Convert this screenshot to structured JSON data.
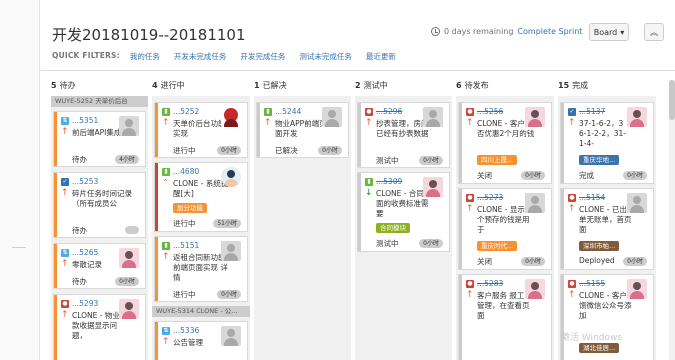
{
  "header": {
    "title": "开发20181019--20181101",
    "days_remaining": "0 days remaining",
    "complete_sprint": "Complete Sprint",
    "board_button": "Board",
    "collapse_icon": "chevron-up-icon"
  },
  "quick_filters": {
    "label": "QUICK FILTERS:",
    "items": [
      "我的任务",
      "开发未完成任务",
      "开发完成任务",
      "测试未完成任务",
      "最近更新"
    ]
  },
  "colors": {
    "link": "#3572b0",
    "priority_grab": "#f79232",
    "type_task": "#4a6785",
    "type_subtask": "#4bade8",
    "type_story": "#63ba3c",
    "type_bug": "#d04437",
    "epic_orange": "#f79232",
    "epic_green": "#8eb021",
    "epic_brown": "#815b3a",
    "epic_blue": "#3b73af"
  },
  "columns": {
    "todo": {
      "count": "5",
      "name": "待办",
      "swimlane": "WUYE-5252",
      "swimlane_text": "天单价后台",
      "cards": [
        {
          "key": "...5351",
          "summary": "前后端API集成",
          "status": "待办",
          "estimate": "4小时"
        },
        {
          "key": "...5253",
          "summary": "碎片任务时间记录（所有成员公",
          "status": "待办"
        },
        {
          "key": "...5265",
          "summary": "零散记录",
          "status": "待办",
          "estimate": "0小时"
        },
        {
          "key": "...5293",
          "summary": "CLONE - 物业收款收据显示问题，"
        }
      ]
    },
    "in_progress": {
      "count": "4",
      "name": "进行中",
      "swimlane": "WUYE-5314",
      "swimlane_text": "CLONE - 公...",
      "cards": [
        {
          "key": "...5252",
          "summary": "天单价后台功能实现",
          "status": "进行中",
          "estimate": "0小时"
        },
        {
          "key": "...4680",
          "summary": "CLONE - 系统提醒[大]",
          "epic": "加分功能",
          "status": "进行中",
          "estimate": "51小时"
        },
        {
          "key": "...5151",
          "summary": "返租合同新功能-前端页面实现 详情",
          "status": "进行中",
          "estimate": "0小时"
        },
        {
          "key": "...5336",
          "summary": "公告管理"
        }
      ]
    },
    "resolved": {
      "count": "1",
      "name": "已解决",
      "cards": [
        {
          "key": "...5244",
          "summary": "物业APP前端页面开发",
          "status": "已解决",
          "estimate": "0小时"
        }
      ]
    },
    "testing": {
      "count": "2",
      "name": "测试中",
      "cards": [
        {
          "key": "...5296",
          "summary": "抄表管理，房间已经有抄表数据",
          "status": "测试中",
          "estimate": "0小时"
        },
        {
          "key": "...5309",
          "summary": "CLONE - 合同里面的收费标准需要",
          "epic": "合同模块",
          "status": "测试中",
          "estimate": "0小时"
        }
      ]
    },
    "to_release": {
      "count": "6",
      "name": "待发布",
      "cards": [
        {
          "key": "...5256",
          "summary": "CLONE - 客户是否优惠2个月的钱",
          "epic": "四川上晟...",
          "status": "关闭",
          "estimate": "0小时"
        },
        {
          "key": "...5273",
          "summary": "CLONE - 显示这个预存的钱是用于",
          "epic": "重庆时代...",
          "status": "关闭",
          "estimate": "0小时"
        },
        {
          "key": "...5283",
          "summary": "客户服务 报工单管理，在查看页面"
        }
      ]
    },
    "done": {
      "count": "15",
      "name": "完成",
      "cards": [
        {
          "key": "...5137",
          "summary": "37-1-6-2，36-1-2-2，31-1-4-",
          "epic": "重庆华地...",
          "status": "完成",
          "estimate": "0小时"
        },
        {
          "key": "...5154",
          "summary": "CLONE - 已出账单无账单，首页面",
          "epic": "深圳市帕...",
          "status": "Deployed",
          "estimate": "0小时"
        },
        {
          "key": "...5155",
          "summary": "CLONE - 客户反馈微信公众号添加",
          "epic": "湖北佳居..."
        }
      ]
    }
  },
  "watermark": "激活 Windows"
}
